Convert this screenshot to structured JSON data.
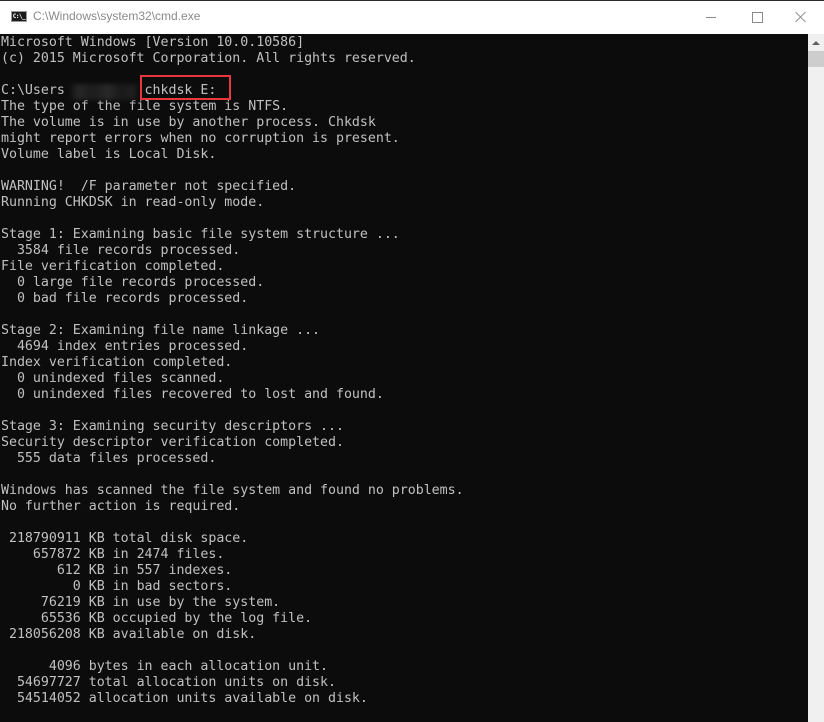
{
  "window": {
    "title": "C:\\Windows\\system32\\cmd.exe",
    "app_icon_label": "C:\\_",
    "controls": {
      "minimize": "minimize",
      "maximize": "maximize",
      "close": "close"
    }
  },
  "console": {
    "highlighted_command": "chkdsk E:",
    "lines": [
      "Microsoft Windows [Version 10.0.10586]",
      "(c) 2015 Microsoft Corporation. All rights reserved.",
      "",
      "C:\\Users          chkdsk E:",
      "The type of the file system is NTFS.",
      "The volume is in use by another process. Chkdsk",
      "might report errors when no corruption is present.",
      "Volume label is Local Disk.",
      "",
      "WARNING!  /F parameter not specified.",
      "Running CHKDSK in read-only mode.",
      "",
      "Stage 1: Examining basic file system structure ...",
      "  3584 file records processed.",
      "File verification completed.",
      "  0 large file records processed.",
      "  0 bad file records processed.",
      "",
      "Stage 2: Examining file name linkage ...",
      "  4694 index entries processed.",
      "Index verification completed.",
      "  0 unindexed files scanned.",
      "  0 unindexed files recovered to lost and found.",
      "",
      "Stage 3: Examining security descriptors ...",
      "Security descriptor verification completed.",
      "  555 data files processed.",
      "",
      "Windows has scanned the file system and found no problems.",
      "No further action is required.",
      "",
      " 218790911 KB total disk space.",
      "    657872 KB in 2474 files.",
      "       612 KB in 557 indexes.",
      "         0 KB in bad sectors.",
      "     76219 KB in use by the system.",
      "     65536 KB occupied by the log file.",
      " 218056208 KB available on disk.",
      "",
      "      4096 bytes in each allocation unit.",
      "  54697727 total allocation units on disk.",
      "  54514052 allocation units available on disk."
    ]
  },
  "scrollbar": {
    "position_percent": 0
  },
  "colors": {
    "console_bg": "#0c0c0c",
    "console_fg": "#c0c0c0",
    "highlight": "#e8383d"
  }
}
